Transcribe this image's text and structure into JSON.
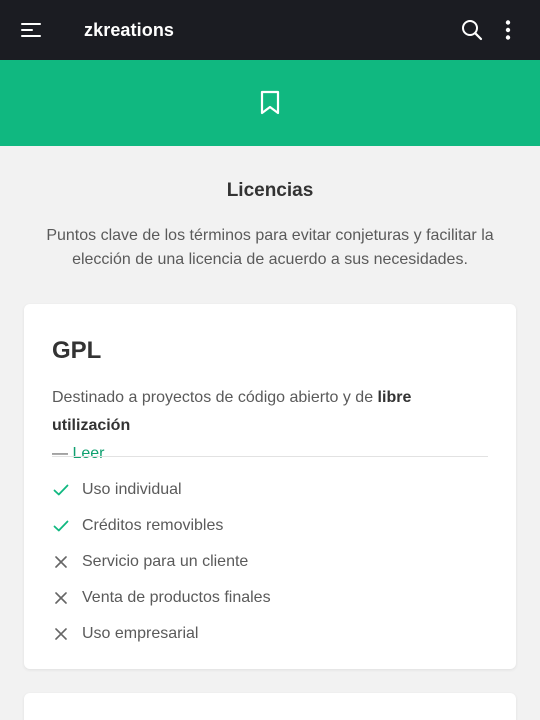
{
  "app": {
    "title": "zkreations"
  },
  "icons": {
    "menu": "menu-icon",
    "search": "search-icon",
    "more": "more-vertical-icon",
    "hero": "bookmark-icon",
    "included": "check-icon",
    "excluded": "close-icon"
  },
  "colors": {
    "topbar": "#1b1c22",
    "accent": "#10b880",
    "link": "#10a070",
    "background": "#f2f2f2",
    "check": "#10b880",
    "cross": "#666666"
  },
  "section": {
    "title": "Licencias",
    "description": "Puntos clave de los términos para evitar conjeturas y facilitar la elección de una licencia de acuerdo a sus necesidades."
  },
  "license": {
    "name": "GPL",
    "desc_prefix": "Destinado a proyectos de código abierto y de ",
    "desc_bold": "libre utilización",
    "desc_dash": "—",
    "read_label": "Leer",
    "features": [
      {
        "label": "Uso individual",
        "included": true
      },
      {
        "label": "Créditos removibles",
        "included": true
      },
      {
        "label": "Servicio para un cliente",
        "included": false
      },
      {
        "label": "Venta de productos finales",
        "included": false
      },
      {
        "label": "Uso empresarial",
        "included": false
      }
    ]
  }
}
